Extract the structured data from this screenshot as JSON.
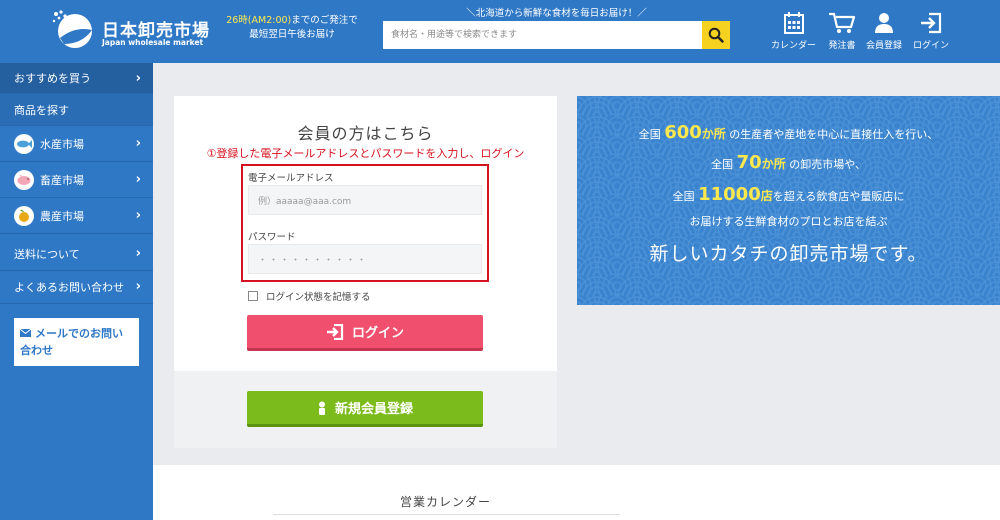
{
  "header": {
    "logo_title": "日本卸売市場",
    "logo_sub": "Japan wholesale market",
    "notice_line1_hl": "26時(AM2:00)",
    "notice_line1_rest": "までのご発注で",
    "notice_line2": "最短翌日午後お届け",
    "tagline": "＼北海道から新鮮な食材を毎日お届け！／",
    "search_placeholder": "食材名・用途等で検索できます",
    "nav": {
      "calendar": "カレンダー",
      "orders": "発注書",
      "register": "会員登録",
      "login": "ログイン"
    }
  },
  "sidebar": {
    "recommended": "おすすめを買う",
    "search_head": "商品を探す",
    "categories": [
      "水産市場",
      "畜産市場",
      "農産市場"
    ],
    "shipping": "送料について",
    "faq": "よくあるお問い合わせ",
    "mail_contact": "メールでのお問い合わせ"
  },
  "login": {
    "title": "会員の方はこちら",
    "instruction": "①登録した電子メールアドレスとパスワードを入力し、ログイン",
    "email_label": "電子メールアドレス",
    "email_placeholder": "例）aaaaa@aaa.com",
    "password_label": "パスワード",
    "password_mask": "・・・・・・・・・・",
    "remember_label": "ログイン状態を記憶する",
    "login_button": "ログイン",
    "register_button": "新規会員登録"
  },
  "promo": {
    "l1_pre": "全国 ",
    "l1_big": "600",
    "l1_unit": "か所",
    "l1_post": " の生産者や産地を中心に直接仕入を行い、",
    "l2_pre": "全国 ",
    "l2_big": "70",
    "l2_unit": "か所",
    "l2_post": " の卸売市場や、",
    "l3_pre": "全国 ",
    "l3_big": "11000",
    "l3_unit": "店",
    "l3_post": "を超える飲食店や量販店に",
    "l4": "お届けする生鮮食材のプロとお店を結ぶ",
    "main": "新しいカタチの卸売市場です。"
  },
  "calendar_title": "営業カレンダー",
  "colors": {
    "brand_blue": "#2f78c6",
    "login_pink": "#f0506d",
    "register_green": "#7cbb1c",
    "highlight_yellow": "#ffe84d",
    "instruction_red": "#d5121f"
  }
}
